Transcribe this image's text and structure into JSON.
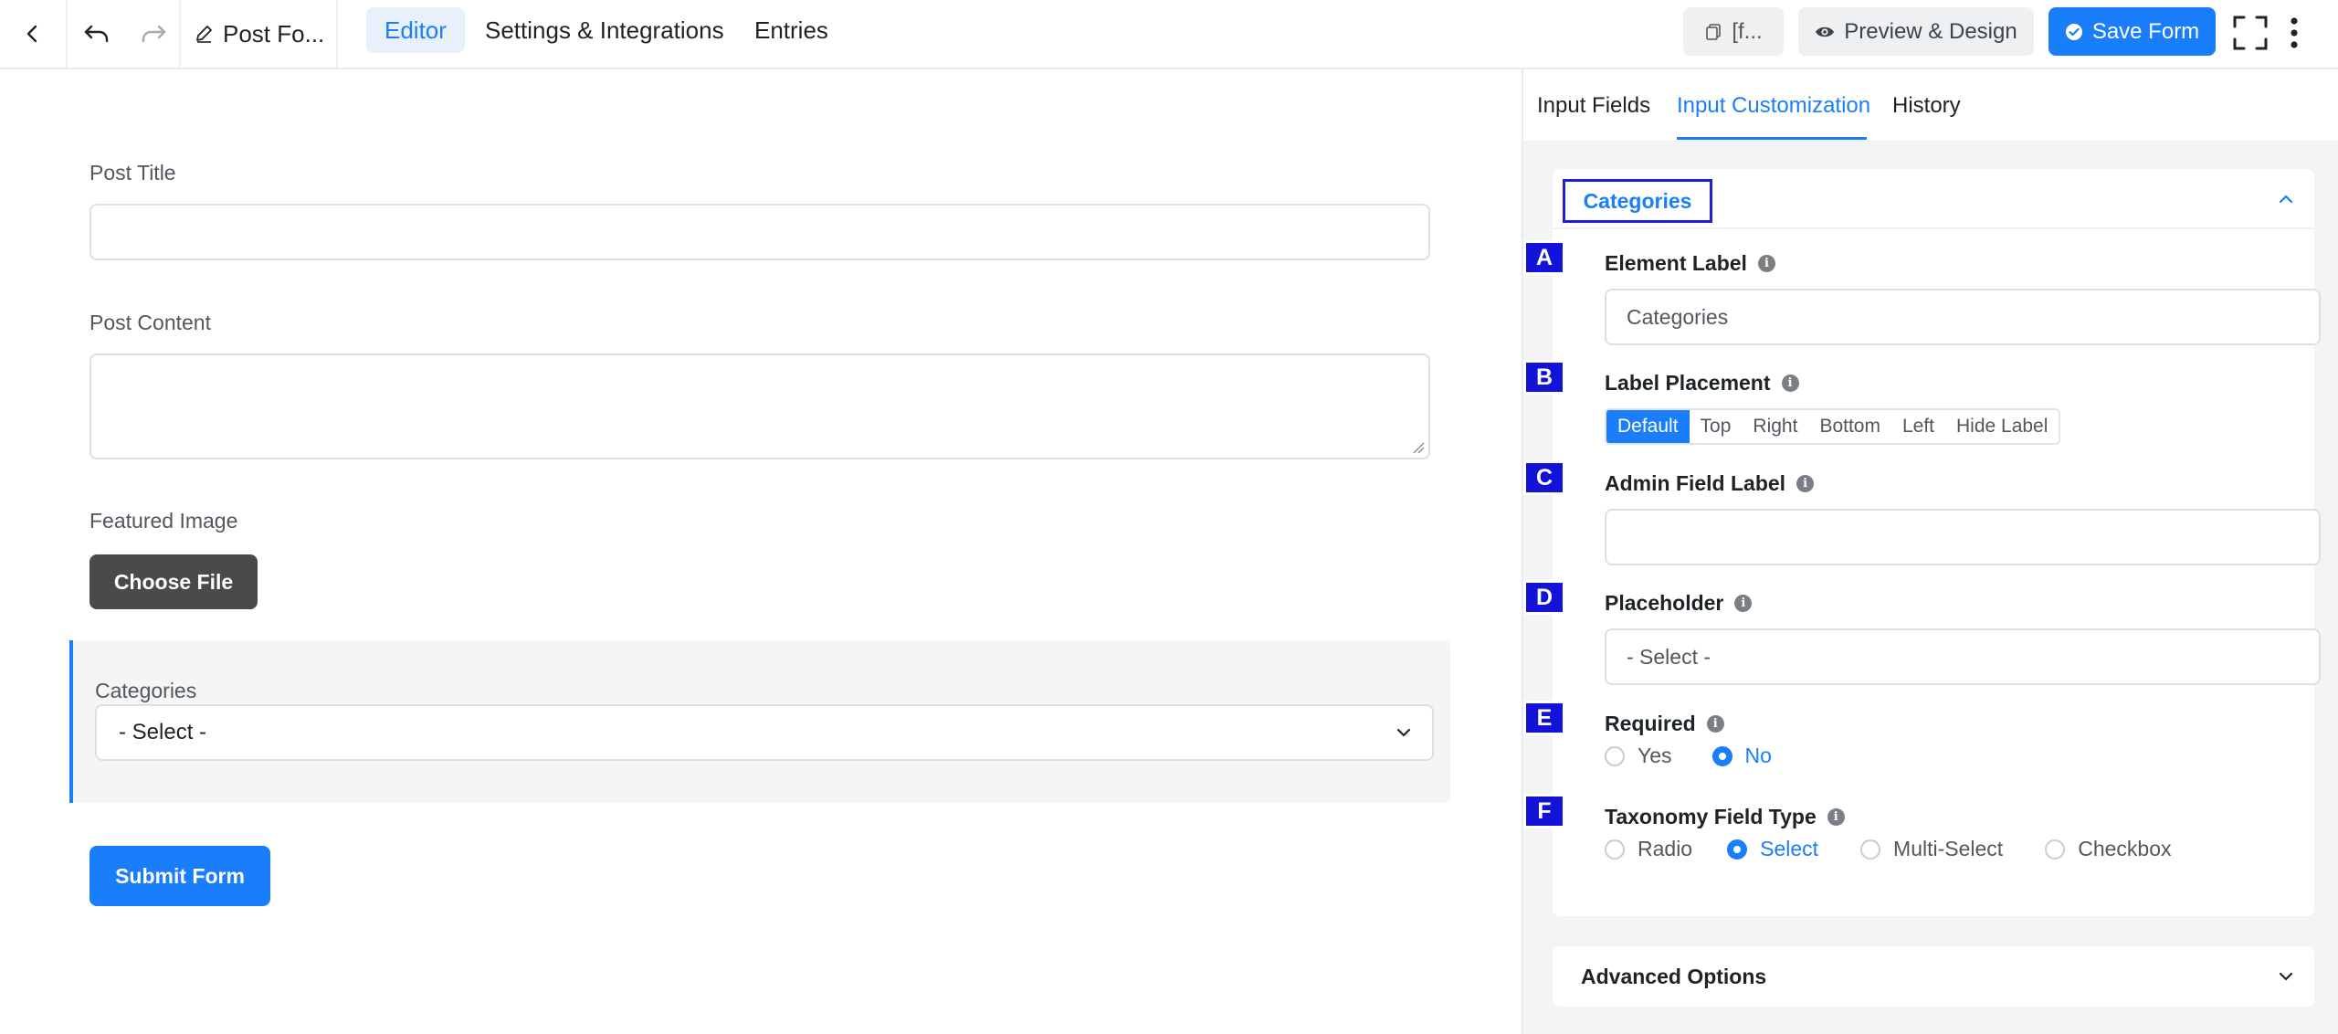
{
  "topbar": {
    "form_name": "Post Fo...",
    "tabs": [
      {
        "label": "Editor",
        "active": true
      },
      {
        "label": "Settings & Integrations",
        "active": false
      },
      {
        "label": "Entries",
        "active": false
      }
    ],
    "shortcode_label": "[f...",
    "preview_label": "Preview & Design",
    "save_label": "Save Form"
  },
  "form": {
    "post_title_label": "Post Title",
    "post_content_label": "Post Content",
    "featured_image_label": "Featured Image",
    "choose_file_label": "Choose File",
    "categories_label": "Categories",
    "categories_select_value": "- Select -",
    "submit_label": "Submit Form"
  },
  "panel": {
    "tabs": [
      {
        "label": "Input Fields",
        "active": false
      },
      {
        "label": "Input Customization",
        "active": true
      },
      {
        "label": "History",
        "active": false
      }
    ],
    "section_title": "Categories",
    "badges": [
      "A",
      "B",
      "C",
      "D",
      "E",
      "F"
    ],
    "element_label": {
      "label": "Element Label",
      "value": "Categories"
    },
    "label_placement": {
      "label": "Label Placement",
      "options": [
        "Default",
        "Top",
        "Right",
        "Bottom",
        "Left",
        "Hide Label"
      ],
      "selected": "Default"
    },
    "admin_field_label": {
      "label": "Admin Field Label",
      "value": ""
    },
    "placeholder": {
      "label": "Placeholder",
      "value": "- Select -"
    },
    "required": {
      "label": "Required",
      "options": [
        "Yes",
        "No"
      ],
      "selected": "No"
    },
    "taxonomy_field_type": {
      "label": "Taxonomy Field Type",
      "options": [
        "Radio",
        "Select",
        "Multi-Select",
        "Checkbox"
      ],
      "selected": "Select"
    },
    "advanced_options_label": "Advanced Options"
  },
  "colors": {
    "accent": "#1a7efb",
    "badge": "#1212d9",
    "choose_file_bg": "#4a4a4a"
  }
}
